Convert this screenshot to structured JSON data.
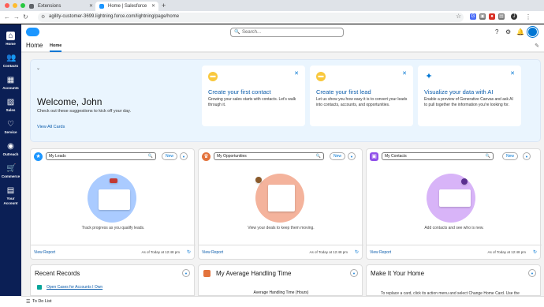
{
  "browser": {
    "tabs": [
      {
        "label": "Extensions",
        "icon": "puzzle-icon"
      },
      {
        "label": "Home | Salesforce",
        "icon": "salesforce-cloud-icon"
      }
    ],
    "url": "agility-customer-3699.lightning.force.com/lightning/page/home"
  },
  "nav": {
    "items": [
      {
        "label": "Home",
        "icon": "home-icon"
      },
      {
        "label": "Contacts",
        "icon": "contacts-icon"
      },
      {
        "label": "Accounts",
        "icon": "accounts-icon"
      },
      {
        "label": "Sales",
        "icon": "sales-icon"
      },
      {
        "label": "Service",
        "icon": "heart-icon"
      },
      {
        "label": "Outreach",
        "icon": "outreach-icon"
      },
      {
        "label": "Commerce",
        "icon": "cart-icon"
      },
      {
        "label": "Your Account",
        "icon": "account-icon"
      }
    ]
  },
  "header": {
    "search_placeholder": "Search...",
    "app_title": "Home",
    "app_tab": "Home"
  },
  "welcome": {
    "title": "Welcome, John",
    "subtitle": "Check out these suggestions to kick off your day.",
    "link": "View All Cards",
    "cards": [
      {
        "title": "Create your first contact",
        "desc": "Growing your sales starts with contacts. Let's walk through it."
      },
      {
        "title": "Create your first lead",
        "desc": "Let us show you how easy it is to convert your leads into contacts, accounts, and opportunities."
      },
      {
        "title": "Visualize your data with AI",
        "desc": "Enable a preview of Generative Canvas and ask AI to pull together the information you're looking for."
      }
    ]
  },
  "lists": [
    {
      "select": "My Leads",
      "new": "New",
      "text": "Track progress as you qualify leads.",
      "view": "View Report",
      "asof": "As of Today at 12:48 pm",
      "color": "#1b96ff"
    },
    {
      "select": "My Opportunities",
      "new": "New",
      "text": "View your deals to keep them moving.",
      "view": "View Report",
      "asof": "As of Today at 12:48 pm",
      "color": "#e3733c"
    },
    {
      "select": "My Contacts",
      "new": "New",
      "text": "Add contacts and see who is new.",
      "view": "View Report",
      "asof": "As of Today at 12:48 pm",
      "color": "#9050e9"
    }
  ],
  "bottom": {
    "recent": {
      "title": "Recent Records",
      "item": "Open Cases for Accounts I Own"
    },
    "aht": {
      "title": "My Average Handling Time",
      "chart_label": "Average Handling Time (Hours)"
    },
    "home": {
      "title": "Make It Your Home",
      "text": "To replace a card, click its action menu and select Change Home Card. Use the"
    }
  },
  "footer": {
    "todo": "To Do List"
  }
}
